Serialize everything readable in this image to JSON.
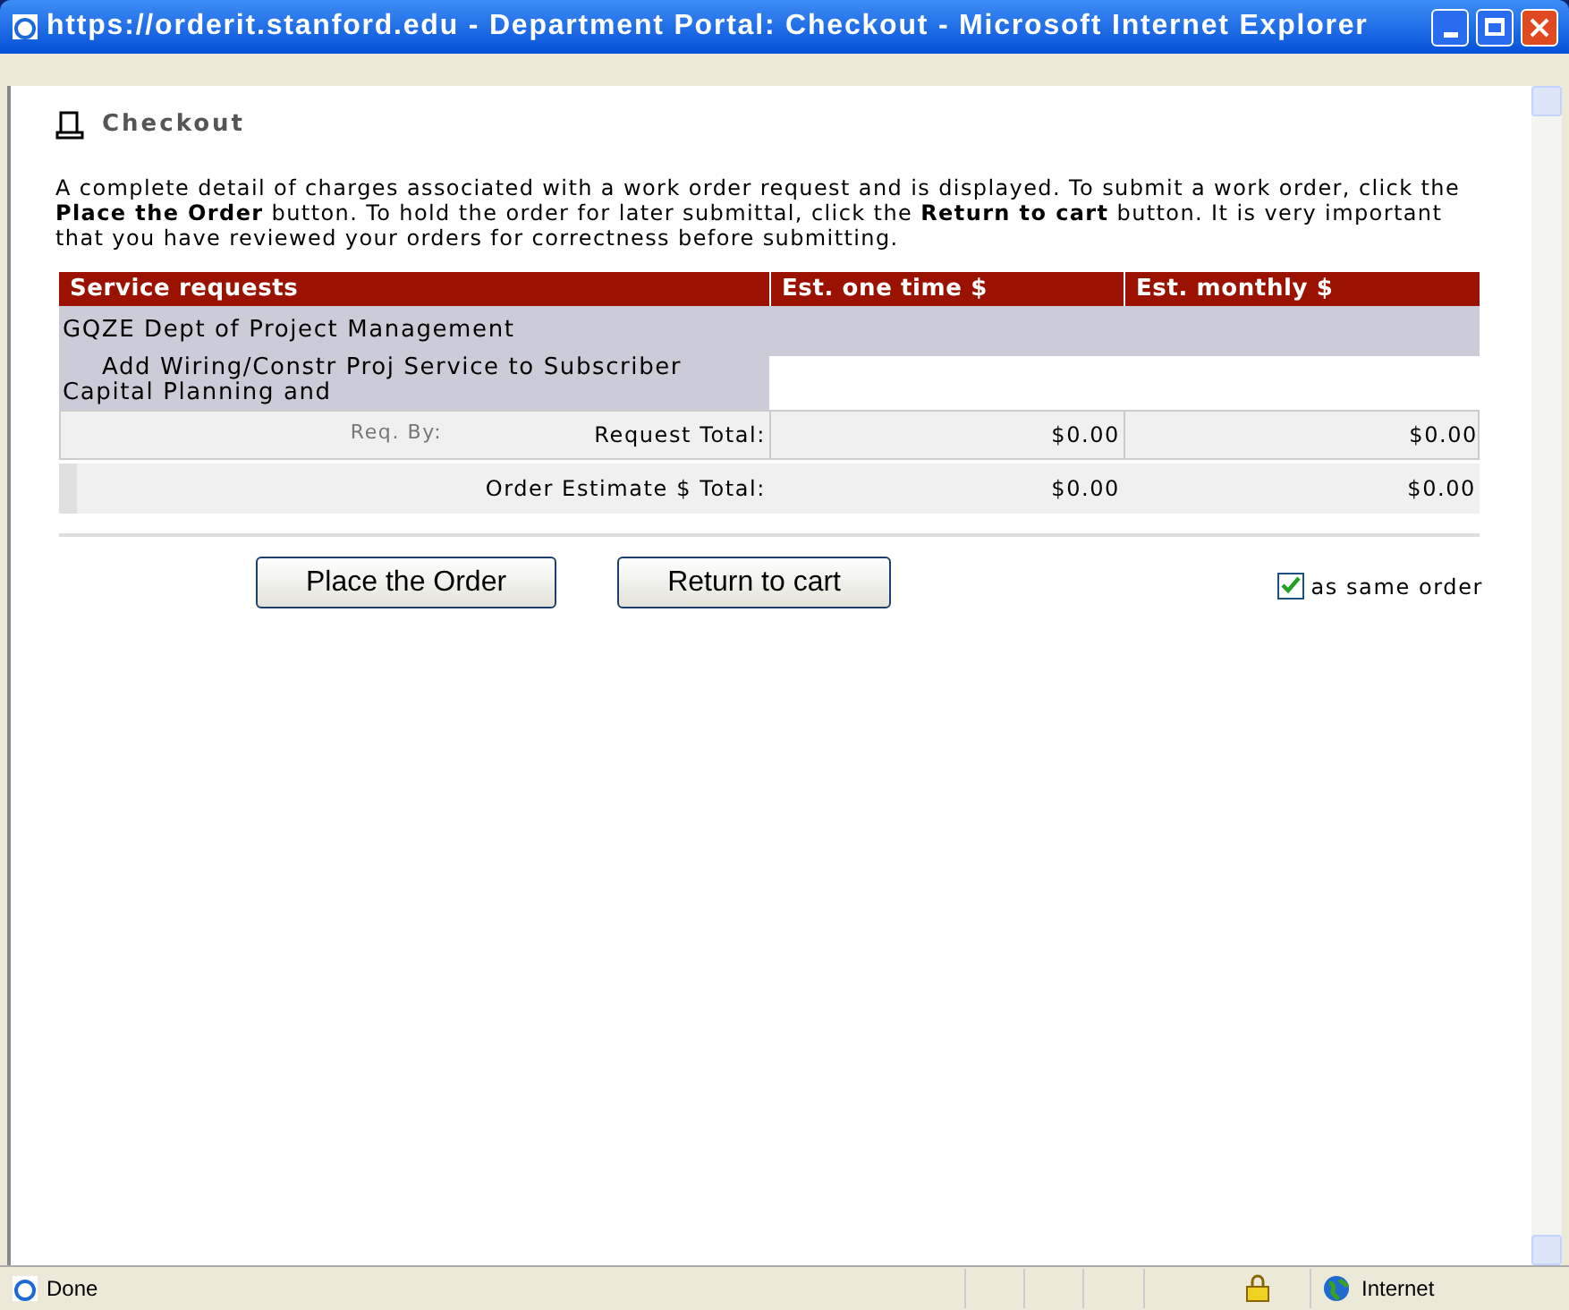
{
  "window": {
    "title": "https://orderit.stanford.edu - Department Portal: Checkout - Microsoft Internet Explorer"
  },
  "page": {
    "heading": "Checkout",
    "description": "A complete detail of charges associated with a work order request and is displayed. To submit a work order, click the **Place the Order** button. To hold the order for later submittal, click the **Return to cart** button. It is very important that you have reviewed your orders for correctness before submitting."
  },
  "table": {
    "columns": [
      "Service requests",
      "Est. one time $",
      "Est. monthly $"
    ],
    "department": "GQZE Dept of Project Management",
    "service_line": "Add Wiring/Constr Proj Service to Subscriber",
    "service_detail": "Capital Planning and",
    "request_total": {
      "req_by": "Req. By:",
      "label": "Request Total:",
      "one_time": "$0.00",
      "monthly": "$0.00"
    },
    "order_total": {
      "label": "Order Estimate $ Total:",
      "one_time": "$0.00",
      "monthly": "$0.00"
    }
  },
  "buttons": [
    "Place the Order",
    "Return to cart"
  ],
  "same_order": {
    "label": "as same order",
    "checked": true
  },
  "status_bar": {
    "text": "Done",
    "zone": "Internet"
  }
}
